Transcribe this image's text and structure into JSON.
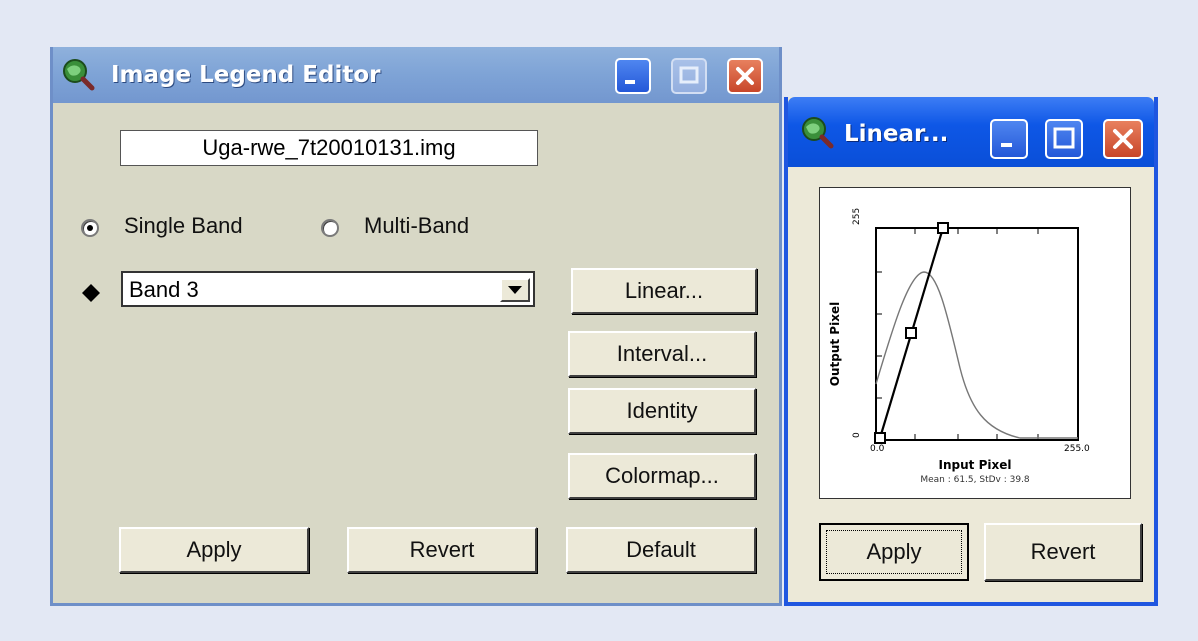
{
  "legend_editor": {
    "title": "Image Legend Editor",
    "filename": "Uga-rwe_7t20010131.img",
    "radio_single": "Single Band",
    "radio_multi": "Multi-Band",
    "selected_mode": "Single Band",
    "band_select": "Band 3",
    "buttons": {
      "linear": "Linear...",
      "interval": "Interval...",
      "identity": "Identity",
      "colormap": "Colormap...",
      "apply": "Apply",
      "revert": "Revert",
      "default": "Default"
    }
  },
  "linear_dialog": {
    "title": "Linear...",
    "apply": "Apply",
    "revert": "Revert",
    "plot": {
      "y_label": "Output Pixel",
      "y_max_tick": "255",
      "y_min_tick": "0",
      "x_label": "Input Pixel",
      "x_min_tick": "0.0",
      "x_max_tick": "255.0",
      "stats": "Mean : 61.5, StDv : 39.8"
    }
  },
  "colors": {
    "xp_blue": "#0e57e6",
    "inactive_title": "#7ea3d6",
    "window_face": "#d8d8c6"
  }
}
